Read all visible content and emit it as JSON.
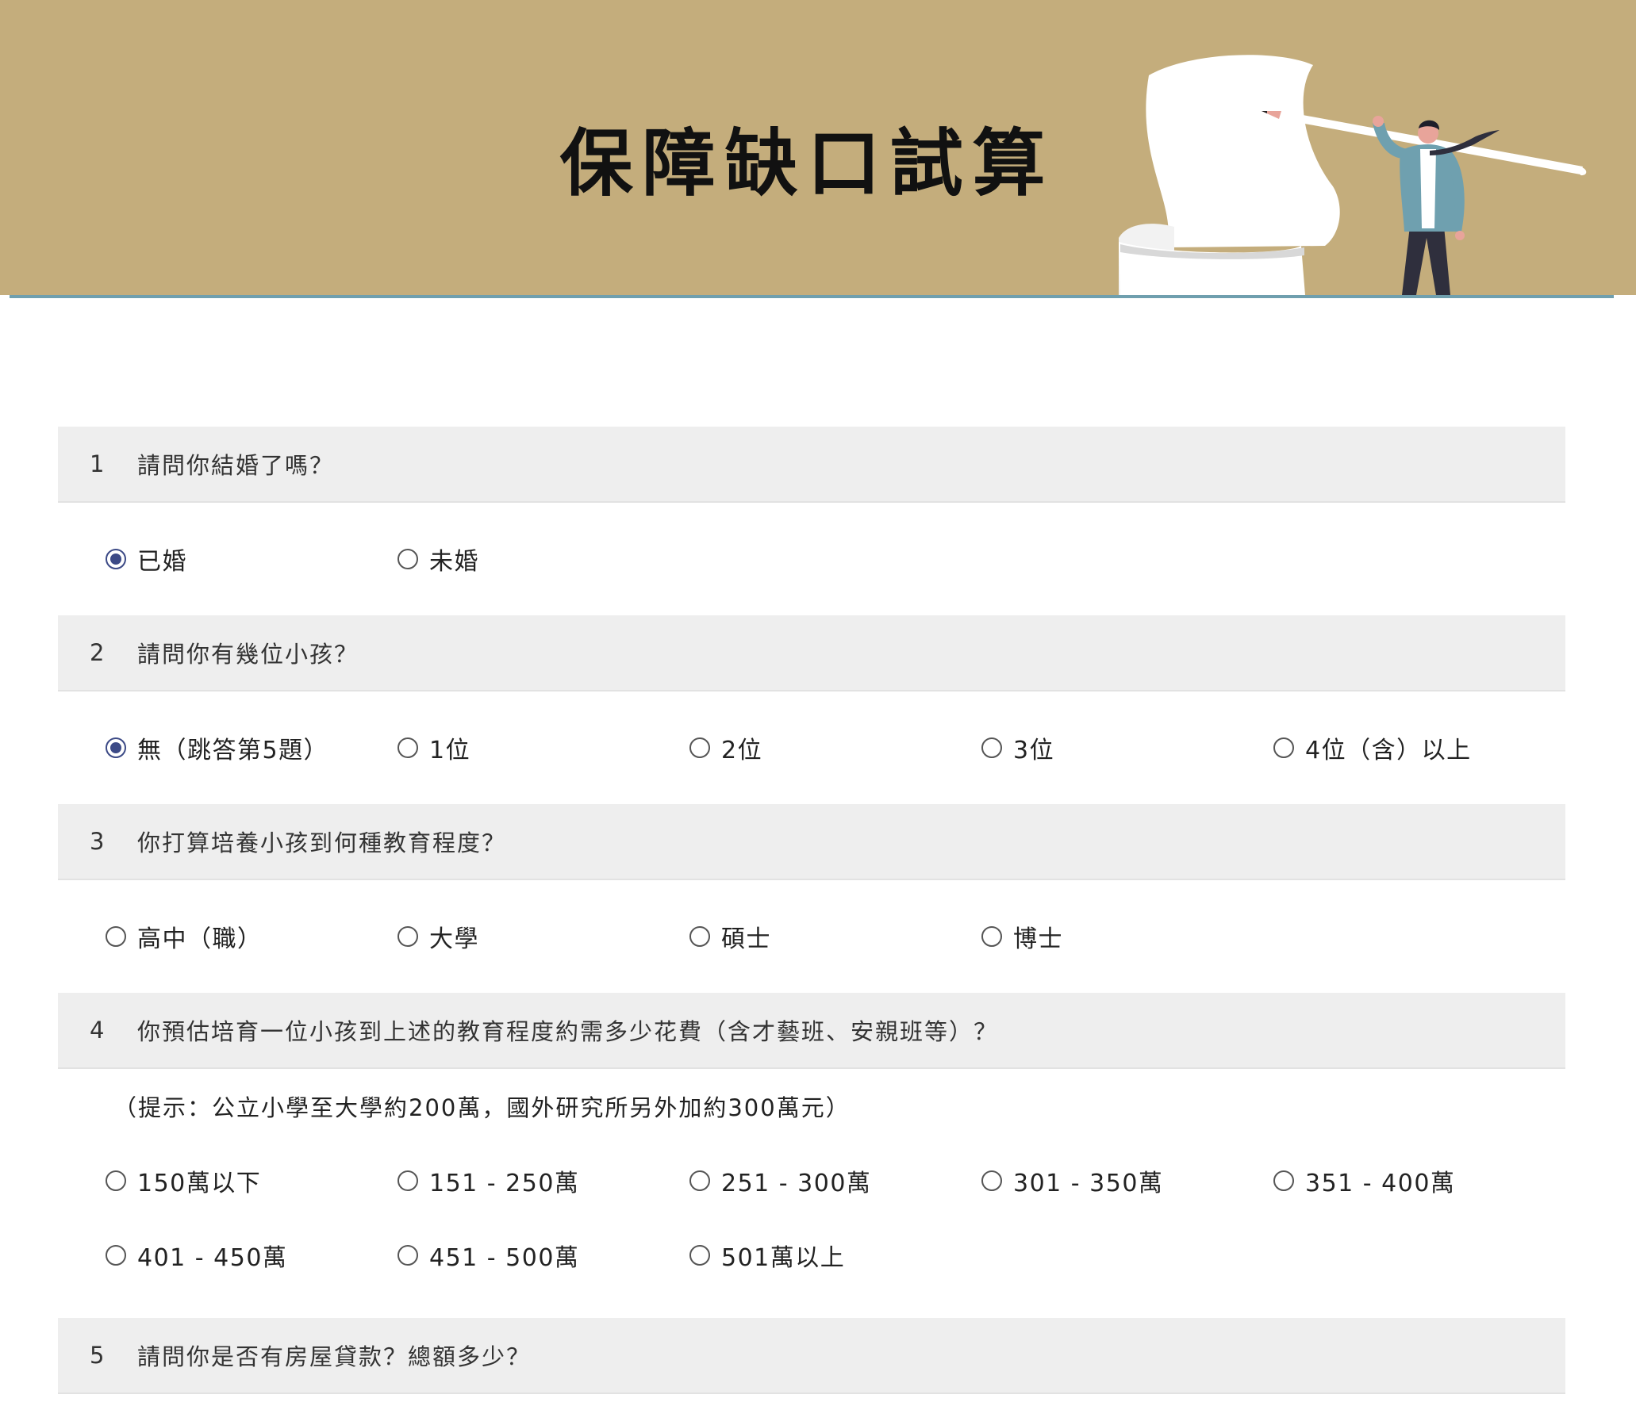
{
  "header": {
    "title": "保障缺口試算"
  },
  "colors": {
    "banner": "#c4ad7c",
    "accent_line": "#6f9fae",
    "radio_checked": "#3c4a86",
    "question_bg": "#eeeeee"
  },
  "questions": [
    {
      "num": "1",
      "text": "請問你結婚了嗎？",
      "options": [
        {
          "label": "已婚",
          "checked": true
        },
        {
          "label": "未婚",
          "checked": false
        }
      ]
    },
    {
      "num": "2",
      "text": "請問你有幾位小孩？",
      "options": [
        {
          "label": "無（跳答第5題）",
          "checked": true
        },
        {
          "label": "1位",
          "checked": false
        },
        {
          "label": "2位",
          "checked": false
        },
        {
          "label": "3位",
          "checked": false
        },
        {
          "label": "4位（含）以上",
          "checked": false
        }
      ]
    },
    {
      "num": "3",
      "text": "你打算培養小孩到何種教育程度？",
      "options": [
        {
          "label": "高中（職）",
          "checked": false
        },
        {
          "label": "大學",
          "checked": false
        },
        {
          "label": "碩士",
          "checked": false
        },
        {
          "label": "博士",
          "checked": false
        }
      ]
    },
    {
      "num": "4",
      "text": "你預估培育一位小孩到上述的教育程度約需多少花費（含才藝班、安親班等）？",
      "hint": "（提示：公立小學至大學約200萬，國外研究所另外加約300萬元）",
      "options": [
        {
          "label": "150萬以下",
          "checked": false
        },
        {
          "label": "151 - 250萬",
          "checked": false
        },
        {
          "label": "251 - 300萬",
          "checked": false
        },
        {
          "label": "301 - 350萬",
          "checked": false
        },
        {
          "label": "351 - 400萬",
          "checked": false
        },
        {
          "label": "401 - 450萬",
          "checked": false
        },
        {
          "label": "451 - 500萬",
          "checked": false
        },
        {
          "label": "501萬以上",
          "checked": false
        }
      ]
    },
    {
      "num": "5",
      "text": "請問你是否有房屋貸款？總額多少？"
    }
  ]
}
